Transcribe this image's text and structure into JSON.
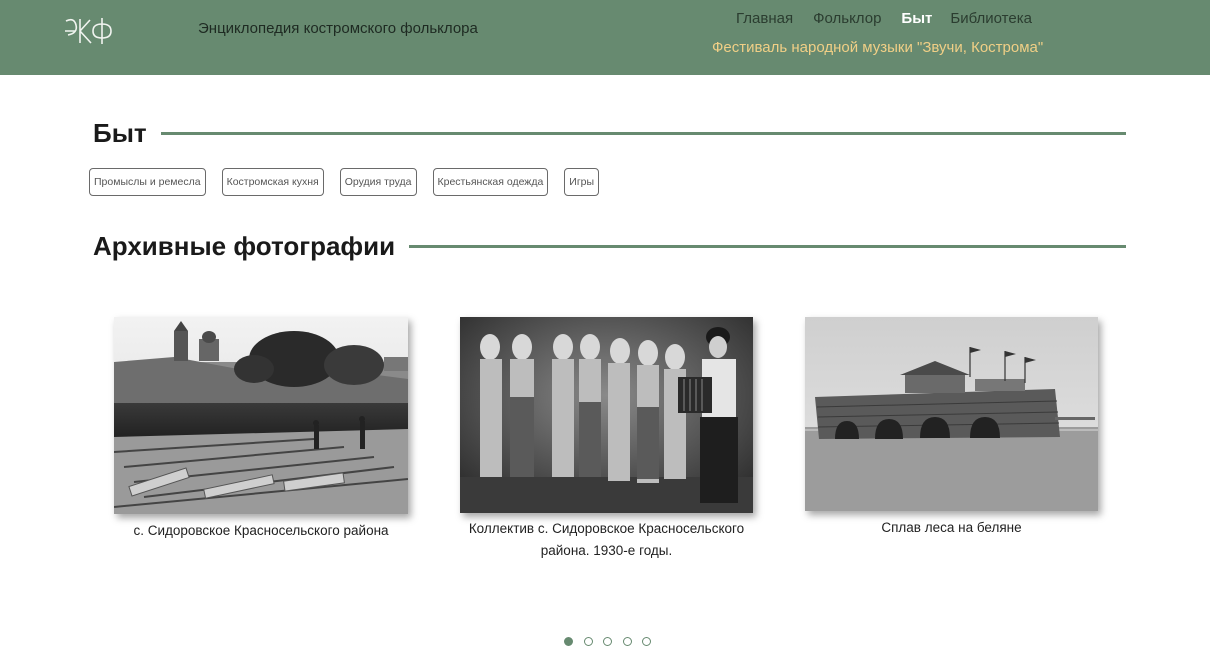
{
  "header": {
    "logo_text": "ЭКФ",
    "site_title": "Энциклопедия костромского фольклора",
    "nav": [
      {
        "label": "Главная",
        "active": false
      },
      {
        "label": "Фольклор",
        "active": false
      },
      {
        "label": "Быт",
        "active": true
      },
      {
        "label": "Библиотека",
        "active": false
      }
    ],
    "festival_link": "Фестиваль народной музыки \"Звучи, Кострома\""
  },
  "byt_section": {
    "title": "Быт",
    "tags": [
      "Промыслы и ремесла",
      "Костромская кухня",
      "Орудия труда",
      "Крестьянская одежда",
      "Игры"
    ]
  },
  "archive_section": {
    "title": "Архивные фотографии",
    "photos": [
      {
        "caption": "с. Сидоровское Красносельского района"
      },
      {
        "caption": "Коллектив с. Сидоровское Красносельского района. 1930-е годы."
      },
      {
        "caption": "Сплав леса на беляне"
      }
    ],
    "carousel": {
      "dots": 5,
      "active_index": 0
    }
  },
  "colors": {
    "header_bg": "#678a70",
    "accent": "#678a70",
    "festival_link": "#f0cf86",
    "active_nav": "#ffffff"
  }
}
